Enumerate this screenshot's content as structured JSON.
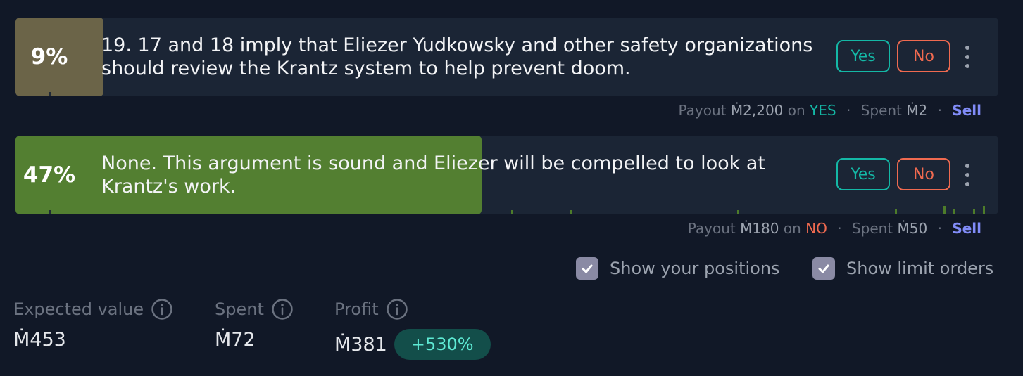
{
  "answers": [
    {
      "prob": "9%",
      "prob_fraction": 0.09,
      "text": "19. 17 and 18 imply that Eliezer Yudkowsky and other safety organizations should review the Krantz system to help prevent doom.",
      "yes_label": "Yes",
      "no_label": "No",
      "payout": {
        "label": "Payout",
        "amount": "Ṁ2,200",
        "on": "on",
        "outcome": "YES",
        "spent_label": "Spent",
        "spent": "Ṁ2",
        "sell": "Sell"
      },
      "fill_color": "#6b6448"
    },
    {
      "prob": "47%",
      "prob_fraction": 0.47,
      "text": "None. This argument is sound and Eliezer will be compelled to look at Krantz's work.",
      "yes_label": "Yes",
      "no_label": "No",
      "payout": {
        "label": "Payout",
        "amount": "Ṁ180",
        "on": "on",
        "outcome": "NO",
        "spent_label": "Spent",
        "spent": "Ṁ50",
        "sell": "Sell"
      },
      "fill_color": "#537f31"
    }
  ],
  "options": {
    "show_positions": "Show your positions",
    "show_limit_orders": "Show limit orders",
    "show_positions_checked": true,
    "show_limit_orders_checked": true
  },
  "stats": {
    "expected_value_label": "Expected value",
    "expected_value": "Ṁ453",
    "spent_label": "Spent",
    "spent": "Ṁ72",
    "profit_label": "Profit",
    "profit": "Ṁ381",
    "profit_pct": "+530%"
  },
  "colors": {
    "yes": "#14b8a6",
    "no": "#f06a50",
    "sell": "#818cf8",
    "background": "#111827",
    "card": "#1b2535"
  }
}
